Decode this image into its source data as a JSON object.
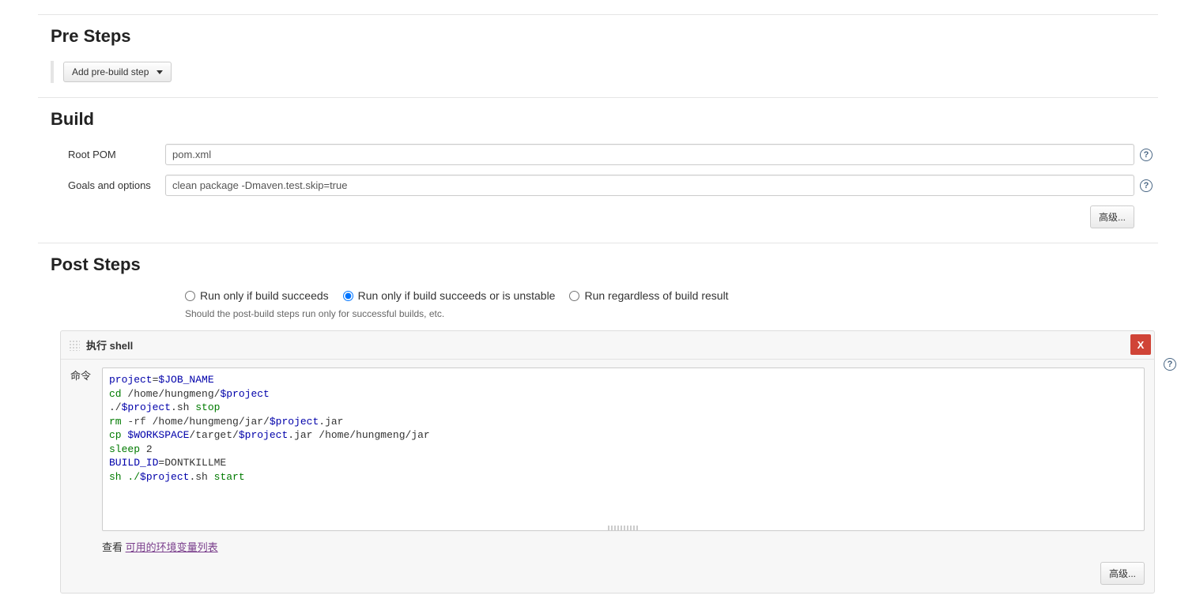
{
  "sections": {
    "pre_steps_title": "Pre Steps",
    "build_title": "Build",
    "post_steps_title": "Post Steps"
  },
  "buttons": {
    "add_pre_build_step": "Add pre-build step",
    "advanced": "高级..."
  },
  "build": {
    "root_pom_label": "Root POM",
    "root_pom_value": "pom.xml",
    "goals_label": "Goals and options",
    "goals_value": "clean package -Dmaven.test.skip=true"
  },
  "post_steps": {
    "radio_succeeds": "Run only if build succeeds",
    "radio_unstable": "Run only if build succeeds or is unstable",
    "radio_regardless": "Run regardless of build result",
    "selected": "unstable",
    "hint": "Should the post-build steps run only for successful builds, etc."
  },
  "shell_block": {
    "title": "执行 shell",
    "command_label": "命令",
    "delete_label": "X",
    "env_prefix": "查看 ",
    "env_link": "可用的环境变量列表",
    "code": {
      "l1a": "project",
      "l1b": "=",
      "l1c": "$JOB_NAME",
      "l2a": "cd ",
      "l2b": "/home/hungmeng/",
      "l2c": "$project",
      "l3a": "./",
      "l3b": "$project",
      "l3c": ".sh ",
      "l3d": "stop",
      "l4a": "rm ",
      "l4b": "-rf ",
      "l4c": "/home/hungmeng/jar/",
      "l4d": "$project",
      "l4e": ".jar",
      "l5a": "cp ",
      "l5b": "$WORKSPACE",
      "l5c": "/target/",
      "l5d": "$project",
      "l5e": ".jar /home/hungmeng/jar",
      "l6a": "sleep ",
      "l6b": "2",
      "l7a": "BUILD_ID",
      "l7b": "=DONTKILLME",
      "l8a": "sh ./",
      "l8b": "$project",
      "l8c": ".sh ",
      "l8d": "start"
    }
  }
}
